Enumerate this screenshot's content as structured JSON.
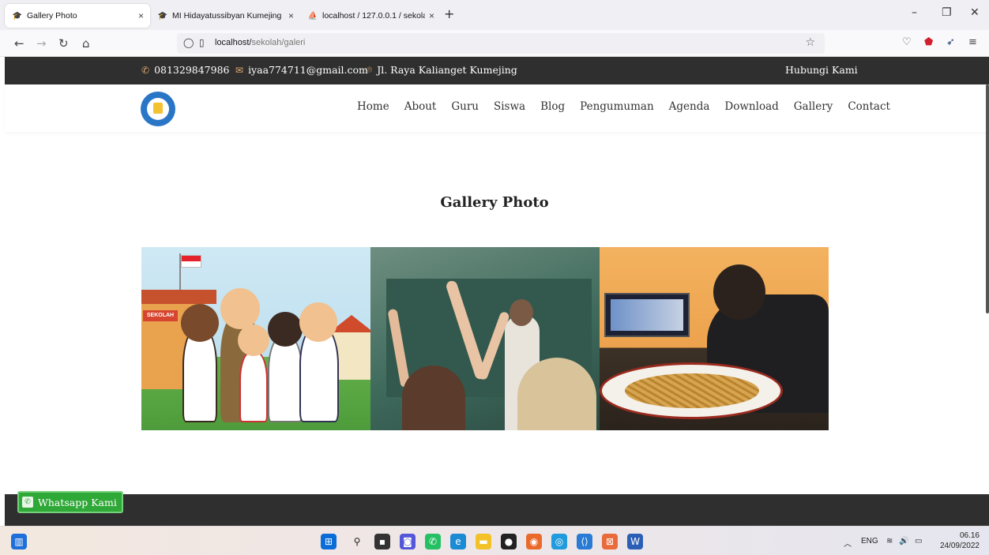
{
  "browser": {
    "tabs": [
      {
        "title": "Gallery Photo",
        "close": "×"
      },
      {
        "title": "MI Hidayatussibyan Kumejing |",
        "close": "×"
      },
      {
        "title": "localhost / 127.0.0.1 / sekolah /",
        "close": "×"
      }
    ],
    "new_tab": "+",
    "url_host": "localhost/",
    "url_path": "sekolah/galeri"
  },
  "topbar": {
    "phone": "081329847986",
    "email": "iyaa774711@gmail.com",
    "address": "Jl. Raya Kalianget Kumejing",
    "contact_link": "Hubungi Kami"
  },
  "nav": {
    "items": [
      "Home",
      "About",
      "Guru",
      "Siswa",
      "Blog",
      "Pengumuman",
      "Agenda",
      "Download",
      "Gallery",
      "Contact"
    ]
  },
  "page": {
    "title": "Gallery Photo",
    "photo1_sign": "SEKOLAH"
  },
  "footer": {
    "whatsapp": "Whatsapp Kami"
  },
  "taskbar": {
    "lang": "ENG",
    "time": "06.16",
    "date": "24/09/2022"
  }
}
